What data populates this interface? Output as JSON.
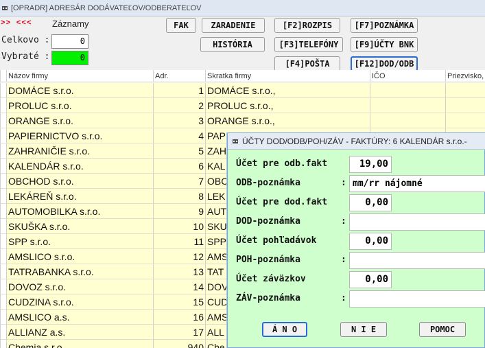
{
  "window": {
    "title": "[OPRADR] ADRESÁR DODÁVATEĽOV/ODBERATEĽOV"
  },
  "header": {
    "arrows": ">> <<<",
    "records_label": "Záznamy",
    "total_label": "Celkovo :",
    "total_value": "0",
    "selected_label": "Vybraté :",
    "selected_value": "0"
  },
  "toolbar": {
    "fak": "FAK",
    "zaradenie": "ZARADENIE",
    "historia": "HISTÓRIA",
    "f2": "[F2]ROZPIS",
    "f3": "[F3]TELEFÓNY",
    "f4": "[F4]POŠTA",
    "f7": "[F7]POZNÁMKA",
    "f9": "[F9]ÚČTY BNK",
    "f12": "[F12]DOD/ODB"
  },
  "grid": {
    "columns": [
      "Názov firmy",
      "Adr.",
      "Skratka firmy",
      "IČO",
      "Priezvisko,"
    ],
    "rows": [
      {
        "name": "DOMÁCE s.r.o.",
        "adr": "1",
        "short": "DOMÁCE s.r.o.,"
      },
      {
        "name": "PROLUC s.r.o.",
        "adr": "2",
        "short": "PROLUC s.r.o.,"
      },
      {
        "name": "ORANGE s.r.o.",
        "adr": "3",
        "short": "ORANGE s.r.o.,"
      },
      {
        "name": "PAPIERNICTVO s.r.o.",
        "adr": "4",
        "short": "PAP"
      },
      {
        "name": "ZAHRANIČIE s.r.o.",
        "adr": "5",
        "short": "ZAH"
      },
      {
        "name": "KALENDÁR s.r.o.",
        "adr": "6",
        "short": "KAL"
      },
      {
        "name": "OBCHOD s.r.o.",
        "adr": "7",
        "short": "OBC"
      },
      {
        "name": "LEKÁREŇ s.r.o.",
        "adr": "8",
        "short": "LEK"
      },
      {
        "name": "AUTOMOBILKA s.r.o.",
        "adr": "9",
        "short": "AUT"
      },
      {
        "name": "SKUŠKA s.r.o.",
        "adr": "10",
        "short": "SKU"
      },
      {
        "name": "SPP s.r.o.",
        "adr": "11",
        "short": "SPP"
      },
      {
        "name": "AMSLICO s.r.o.",
        "adr": "12",
        "short": "AMS"
      },
      {
        "name": "TATRABANKA s.r.o.",
        "adr": "13",
        "short": "TAT"
      },
      {
        "name": "DOVOZ s.r.o.",
        "adr": "14",
        "short": "DOV"
      },
      {
        "name": "CUDZINA s.r.o.",
        "adr": "15",
        "short": "CUD"
      },
      {
        "name": "AMSLICO a.s.",
        "adr": "16",
        "short": "AMS"
      },
      {
        "name": "ALLIANZ a.s.",
        "adr": "17",
        "short": "ALL"
      },
      {
        "name": "Chemia s.r.o.",
        "adr": "940",
        "short": "Che"
      }
    ]
  },
  "dialog": {
    "title": "ÚČTY DOD/ODB/POH/ZÁV - FAKTÚRY: 6 KALENDÁR s.r.o.-",
    "fields": [
      {
        "label": "Účet pre odb.fakt",
        "value": "19,00",
        "type": "num"
      },
      {
        "label": "ODB-poznámka",
        "value": "mm/rr nájomné",
        "type": "txt"
      },
      {
        "label": "Účet pre dod.fakt",
        "value": "0,00",
        "type": "num"
      },
      {
        "label": "DOD-poznámka",
        "value": "",
        "type": "txt"
      },
      {
        "label": "Účet pohľadávok",
        "value": "0,00",
        "type": "num"
      },
      {
        "label": "POH-poznámka",
        "value": "",
        "type": "txt"
      },
      {
        "label": "Účet záväzkov",
        "value": "0,00",
        "type": "num"
      },
      {
        "label": "ZÁV-poznámka",
        "value": "",
        "type": "txt"
      }
    ],
    "colon": ":",
    "buttons": {
      "yes": "Á N O",
      "no": "N I E",
      "help": "POMOC"
    }
  }
}
